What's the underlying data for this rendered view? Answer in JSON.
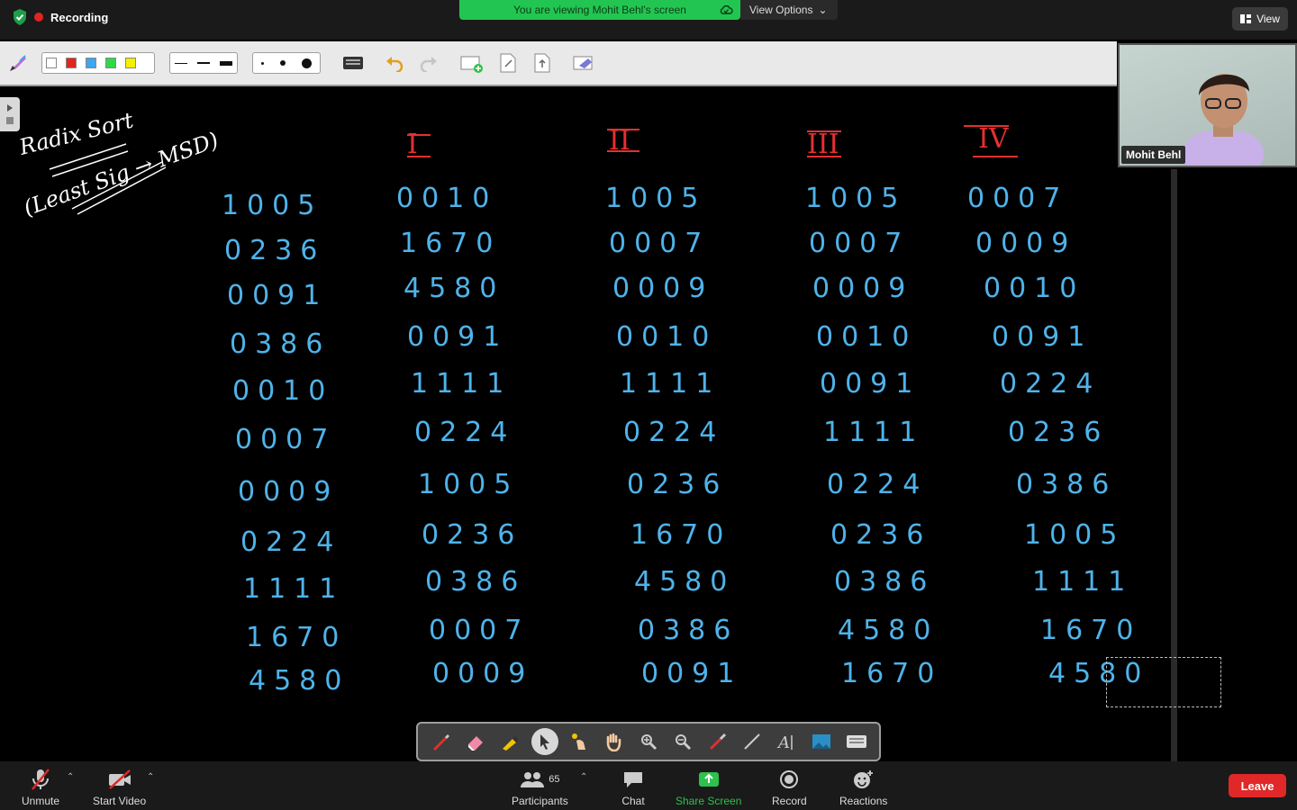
{
  "top_bar": {
    "recording_label": "Recording",
    "banner_text": "You are viewing Mohit Behl's screen",
    "view_options_label": "View Options",
    "view_button_label": "View"
  },
  "colors": {
    "banner_green": "#23c552",
    "leave_red": "#e02828",
    "ink_blue": "#4fb3ea",
    "ink_red": "#e53030"
  },
  "annotation_toolbar": {
    "color_swatches": [
      "#ffffff",
      "#e0241f",
      "#3ea6ea",
      "#2ed84a",
      "#f4f000"
    ],
    "line_widths": [
      "thin",
      "medium",
      "thick"
    ],
    "dot_sizes": [
      "small",
      "medium",
      "large"
    ],
    "icons": [
      "pen-tool-icon",
      "keyboard-icon",
      "undo-icon",
      "redo-icon",
      "new-page-icon",
      "export-icon",
      "save-icon",
      "clear-icon"
    ]
  },
  "whiteboard": {
    "title": "Radix Sort",
    "subtitle": "(Least Sig → MSD)",
    "pass_labels": [
      "I",
      "II",
      "III",
      "IV"
    ],
    "columns": [
      [
        "1005",
        "0236",
        "0091",
        "0386",
        "0010",
        "0007",
        "0009",
        "0224",
        "1111",
        "1670",
        "4580"
      ],
      [
        "0010",
        "1670",
        "4580",
        "0091",
        "1111",
        "0224",
        "1005",
        "0236",
        "0386",
        "0007",
        "0009"
      ],
      [
        "1005",
        "0007",
        "0009",
        "0010",
        "1111",
        "0224",
        "0236",
        "1670",
        "4580",
        "0386",
        "0091"
      ],
      [
        "1005",
        "0007",
        "0009",
        "0010",
        "0091",
        "1111",
        "0224",
        "0236",
        "0386",
        "4580",
        "1670"
      ],
      [
        "0007",
        "0009",
        "0010",
        "0091",
        "0224",
        "0236",
        "0386",
        "1005",
        "1111",
        "1670",
        "4580"
      ]
    ]
  },
  "participant_video": {
    "name": "Mohit Behl"
  },
  "drawing_toolbar": {
    "tools": [
      "pen-icon",
      "eraser-icon",
      "highlighter-icon",
      "select-arrow-icon",
      "laser-pointer-icon",
      "hand-pan-icon",
      "zoom-in-icon",
      "zoom-out-icon",
      "brush-icon",
      "line-icon",
      "text-icon",
      "image-icon",
      "keyboard-icon"
    ],
    "active_tool": "select-arrow-icon"
  },
  "controls": {
    "unmute_label": "Unmute",
    "start_video_label": "Start Video",
    "participants_label": "Participants",
    "participants_count": "65",
    "chat_label": "Chat",
    "share_screen_label": "Share Screen",
    "record_label": "Record",
    "reactions_label": "Reactions",
    "leave_label": "Leave"
  }
}
